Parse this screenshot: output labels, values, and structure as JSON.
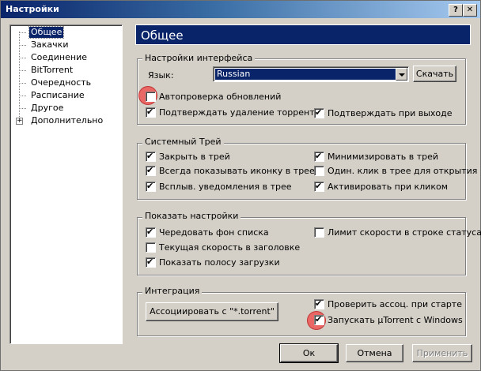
{
  "window": {
    "title": "Настройки",
    "help_glyph": "?",
    "close_glyph": "✕"
  },
  "tree": {
    "items": [
      {
        "label": "Общее",
        "selected": true
      },
      {
        "label": "Закачки"
      },
      {
        "label": "Соединение"
      },
      {
        "label": "BitTorrent"
      },
      {
        "label": "Очередность"
      },
      {
        "label": "Расписание"
      },
      {
        "label": "Другое"
      },
      {
        "label": "Дополнительно",
        "expander": "+"
      }
    ]
  },
  "page": {
    "title": "Общее"
  },
  "interface": {
    "group_label": "Настройки интерфейса",
    "language_label": "Язык:",
    "language_value": "Russian",
    "download_button": "Скачать",
    "auto_update": {
      "label": "Автопроверка обновлений",
      "checked": false
    },
    "confirm_delete": {
      "label": "Подтверждать удаление торрентов",
      "checked": true
    },
    "confirm_exit": {
      "label": "Подтверждать при выходе",
      "checked": true
    }
  },
  "tray": {
    "group_label": "Системный Трей",
    "close_to_tray": {
      "label": "Закрыть в трей",
      "checked": true
    },
    "minimize_to_tray": {
      "label": "Минимизировать в трей",
      "checked": true
    },
    "always_show_icon": {
      "label": "Всегда показывать иконку в трее",
      "checked": true
    },
    "single_click_open": {
      "label": "Один. клик в трее для открытия",
      "checked": false
    },
    "balloon_notifications": {
      "label": "Всплыв. уведомления в трее",
      "checked": true
    },
    "activate_on_click": {
      "label": "Активировать при кликом",
      "checked": true
    }
  },
  "display": {
    "group_label": "Показать настройки",
    "alternate_bg": {
      "label": "Чередовать фон списка",
      "checked": true
    },
    "speed_limit_status": {
      "label": "Лимит скорости в строке статуса",
      "checked": false
    },
    "speed_in_title": {
      "label": "Текущая скорость в заголовке",
      "checked": false
    },
    "show_progress_bar": {
      "label": "Показать полосу загрузки",
      "checked": true
    }
  },
  "integration": {
    "group_label": "Интеграция",
    "associate_button": "Ассоциировать с \"*.torrent\"",
    "check_assoc": {
      "label": "Проверить ассоц. при старте",
      "checked": true
    },
    "start_with_windows": {
      "label": "Запускать µTorrent с Windows",
      "checked": true
    }
  },
  "footer": {
    "ok": "Ок",
    "cancel": "Отмена",
    "apply": "Применить"
  }
}
